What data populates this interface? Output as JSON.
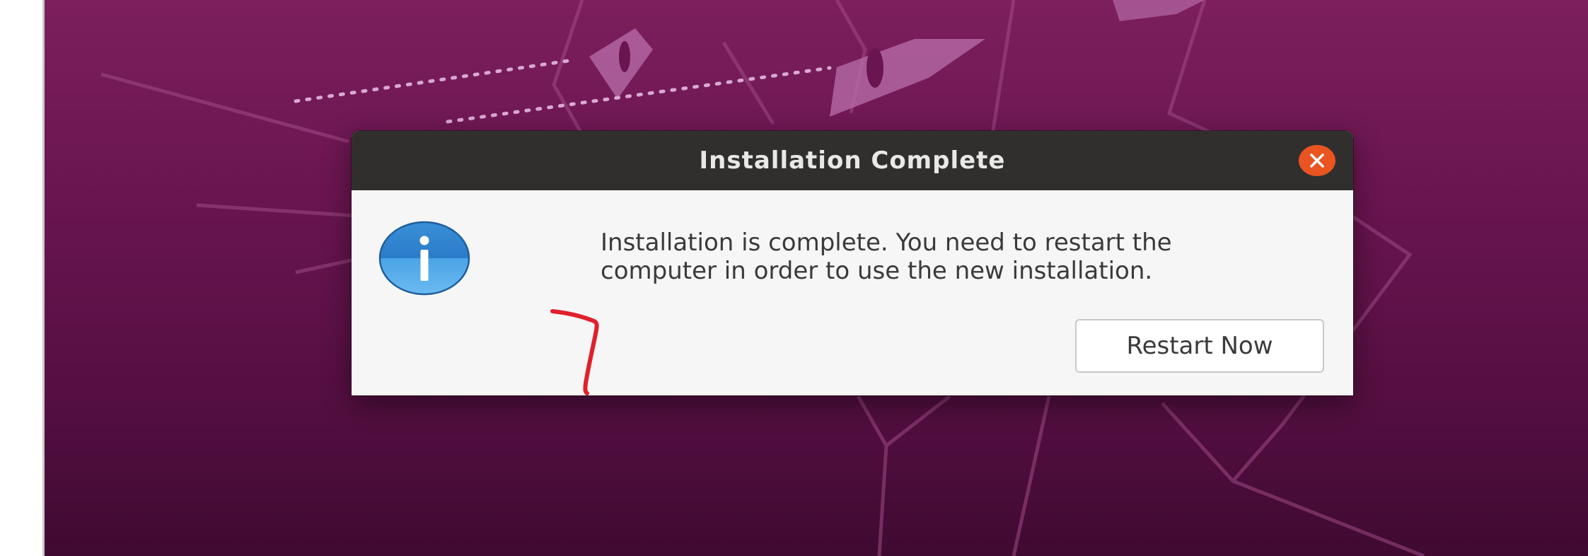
{
  "dialog": {
    "title": "Installation Complete",
    "message_line1": "Installation is complete. You need to restart the",
    "message_line2": "computer in order to use the new installation.",
    "restart_label": "Restart Now",
    "close_icon": "close-icon",
    "info_icon": "info-icon"
  },
  "colors": {
    "titlebar": "#302f2d",
    "close_button": "#e95420",
    "dialog_body": "#f6f6f6",
    "wallpaper": "#6a1550",
    "annotation": "#e0202a"
  }
}
